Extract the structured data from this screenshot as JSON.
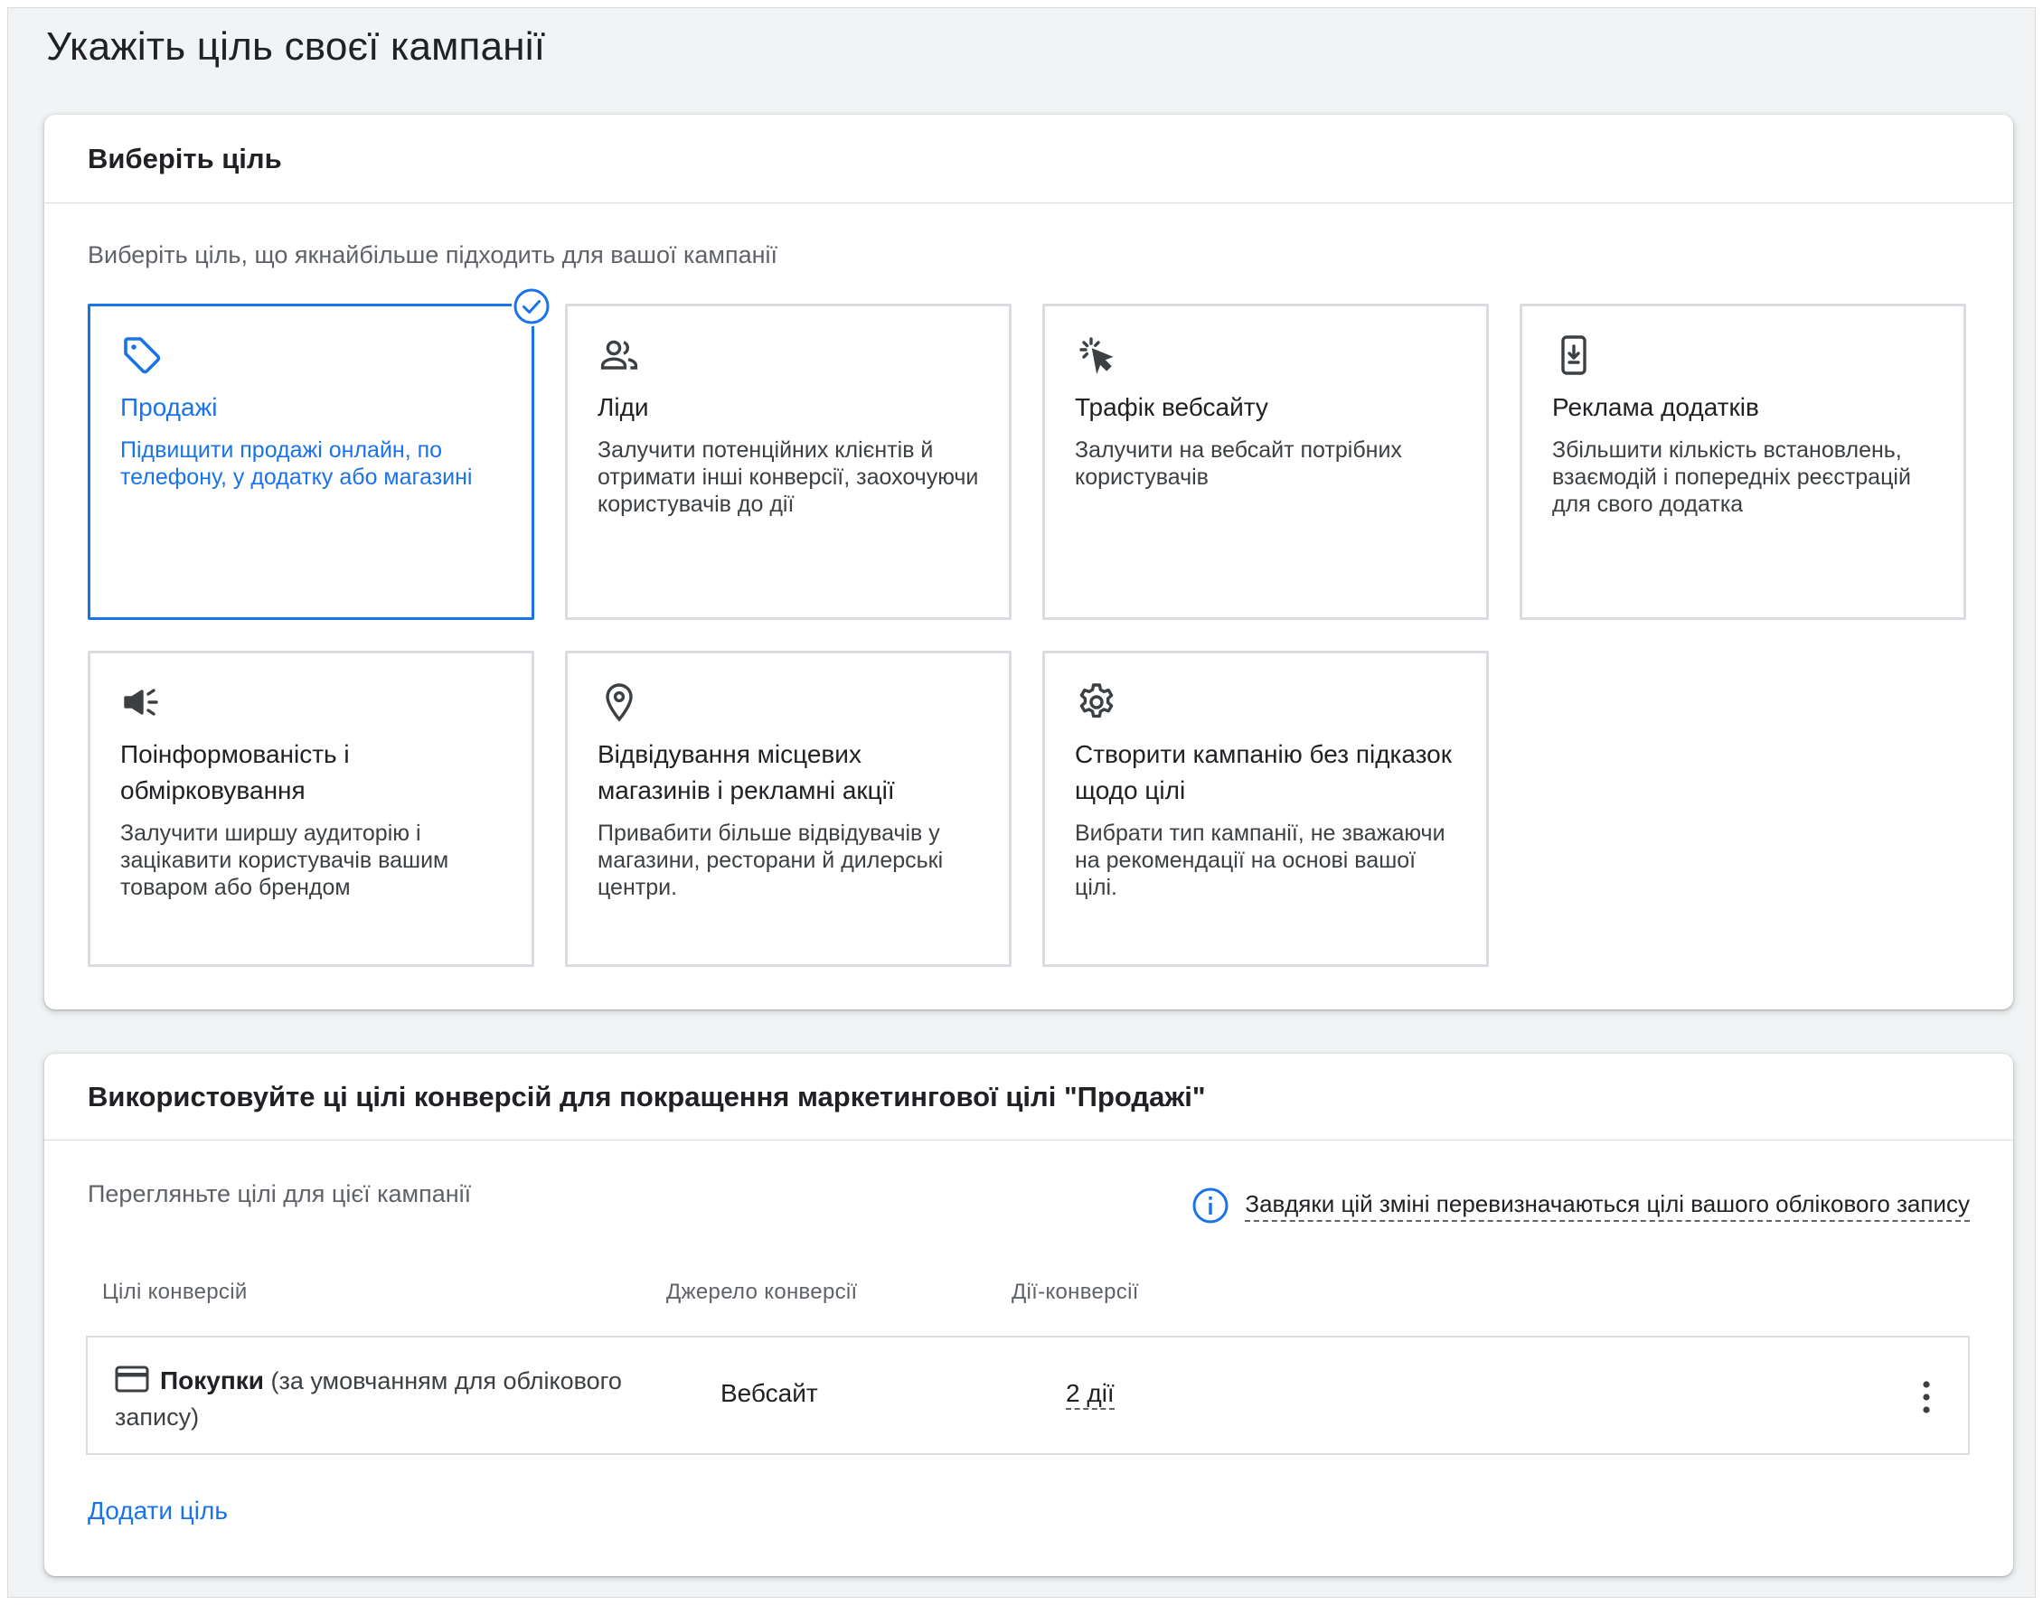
{
  "page": {
    "title": "Укажіть ціль своєї кампанії"
  },
  "goal_section": {
    "header": "Виберіть ціль",
    "subtitle": "Виберіть ціль, що якнайбільше підходить для вашої кампанії",
    "tiles": [
      {
        "icon": "tag-icon",
        "title": "Продажі",
        "description": "Підвищити продажі онлайн, по телефону, у додатку або магазині",
        "selected": true
      },
      {
        "icon": "people-icon",
        "title": "Ліди",
        "description": "Залучити потенційних клієнтів й отримати інші конверсії, заохочуючи користувачів до дії",
        "selected": false
      },
      {
        "icon": "cursor-click-icon",
        "title": "Трафік вебсайту",
        "description": "Залучити на вебсайт потрібних користувачів",
        "selected": false
      },
      {
        "icon": "phone-download-icon",
        "title": "Реклама додатків",
        "description": "Збільшити кількість встановлень, взаємодій і попередніх реєстрацій для свого додатка",
        "selected": false
      },
      {
        "icon": "megaphone-icon",
        "title": "Поінформованість і обмірковування",
        "description": "Залучити ширшу аудиторію і зацікавити користувачів вашим товаром або брендом",
        "selected": false
      },
      {
        "icon": "location-pin-icon",
        "title": "Відвідування місцевих магазинів і рекламні акції",
        "description": "Привабити більше відвідувачів у магазини, ресторани й дилерські центри.",
        "selected": false
      },
      {
        "icon": "gear-icon",
        "title": "Створити кампанію без підказок щодо цілі",
        "description": "Вибрати тип кампанії, не зважаючи на рекомендації на основі вашої цілі.",
        "selected": false
      }
    ]
  },
  "conversion_section": {
    "header": "Використовуйте ці цілі конверсій для покращення маркетингової цілі \"Продажі\"",
    "subtitle": "Перегляньте цілі для цієї кампанії",
    "notice": "Завдяки цій зміні перевизначаються цілі вашого облікового запису",
    "columns": {
      "goals": "Цілі конверсій",
      "source": "Джерело конверсії",
      "actions": "Дії-конверсії"
    },
    "row": {
      "goal_name": "Покупки",
      "goal_note": " (за умовчанням для облікового запису)",
      "source": "Вебсайт",
      "actions": "2 дії"
    },
    "add_goal": "Додати ціль"
  },
  "colors": {
    "accent": "#1a73e8",
    "border": "#dadce0",
    "background": "#f1f3f4"
  }
}
